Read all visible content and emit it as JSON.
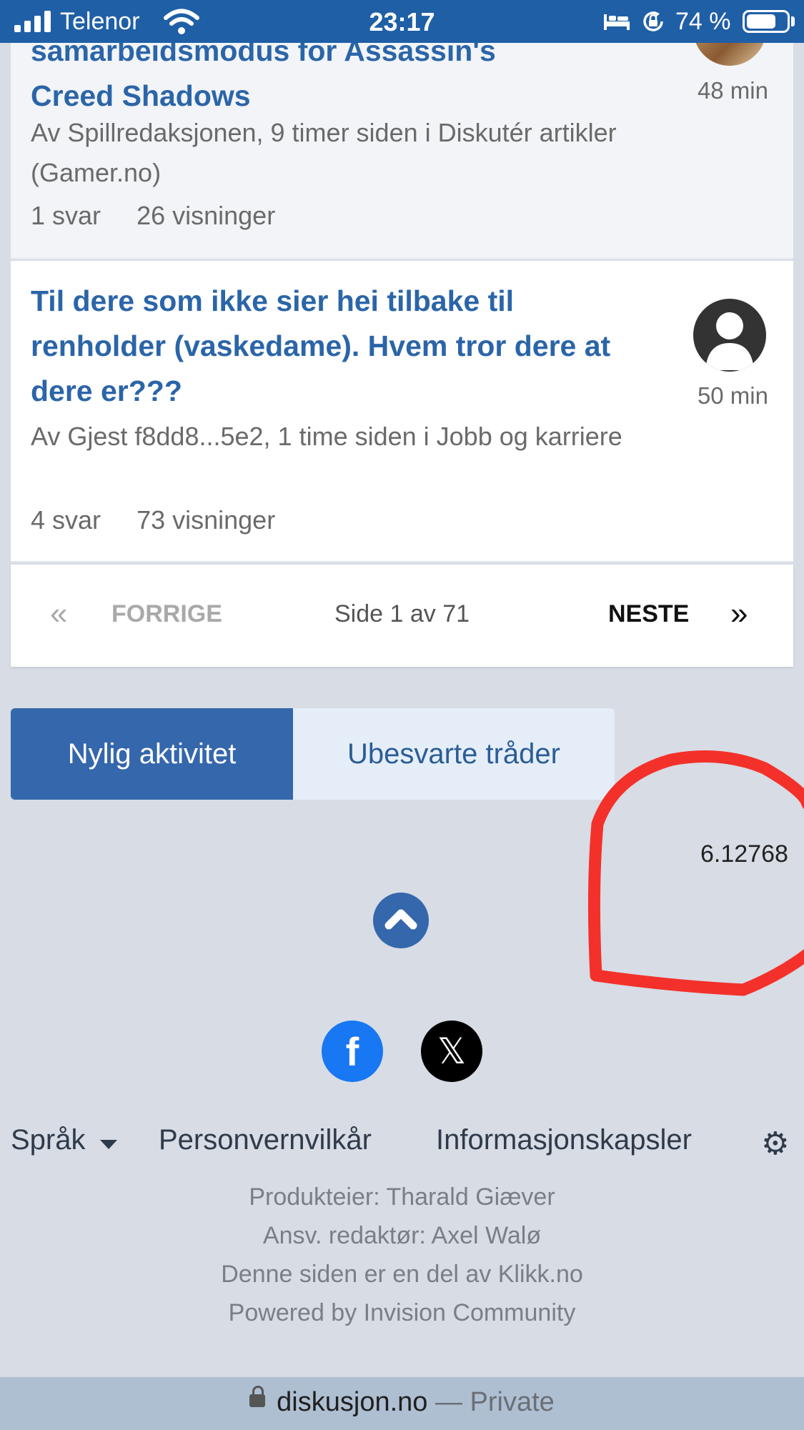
{
  "status_bar": {
    "carrier": "Telenor",
    "time": "23:17",
    "battery_percent": "74 %",
    "battery_level": 0.74,
    "icons": [
      "signal-icon",
      "wifi-icon",
      "bed-icon",
      "orientation-lock-icon",
      "battery-icon"
    ]
  },
  "topics": [
    {
      "title_line1": "samarbeidsmodus for Assassin's",
      "title_line2": "Creed Shadows",
      "meta": "Av Spillredaksjonen, 9 timer siden i Diskutér artikler (Gamer.no)",
      "replies": "1 svar",
      "views": "26 visninger",
      "time_ago": "48 min"
    },
    {
      "title": "Til dere som ikke sier hei tilbake til renholder (vaskedame). Hvem tror dere at dere er???",
      "meta": "Av Gjest f8dd8...5e2, 1 time siden i Jobb og karriere",
      "replies": "4 svar",
      "views": "73 visninger",
      "time_ago": "50 min"
    }
  ],
  "pagination": {
    "prev_icon": "«",
    "prev_label": "FORRIGE",
    "page_info": "Side 1 av 71",
    "next_label": "NESTE",
    "next_icon": "»"
  },
  "tabs": {
    "active": "Nylig aktivitet",
    "inactive": "Ubesvarte tråder"
  },
  "counter": "6.12768",
  "social": {
    "facebook_glyph": "f",
    "x_glyph": "𝕏"
  },
  "footer": {
    "language": "Språk",
    "privacy": "Personvernvilkår",
    "cookies": "Informasjonskapsler",
    "gear_icon": "⚙",
    "credits": [
      "Produkteier: Tharald Giæver",
      "Ansv. redaktør: Axel Walø",
      "Denne siden er en del av Klikk.no",
      "Powered by Invision Community"
    ]
  },
  "url_bar": {
    "domain": "diskusjon.no",
    "mode": " — Private"
  },
  "colors": {
    "status_bar": "#1f5fa6",
    "link": "#2b65a8",
    "accent": "#3467ab",
    "scribble": "#f3312a"
  }
}
